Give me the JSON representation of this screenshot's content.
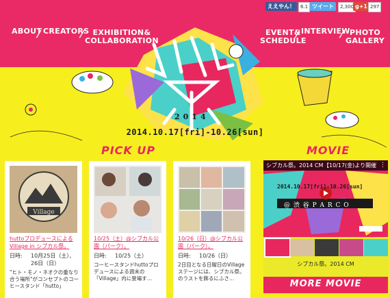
{
  "nav": {
    "about": "ABOUT",
    "creators": "CREATORS",
    "exhibition_line1": "EXHIBITION&",
    "exhibition_line2": "COLLABORATION",
    "event_line1": "EVENT&",
    "event_line2": "SCHEDULE",
    "interview": "INTERVIEW",
    "photo_line1": "PHOTO",
    "photo_line2": "GALLERY"
  },
  "social": {
    "like_label": "ええやん！",
    "like_count": "6.1",
    "tweet_label": "ツイート",
    "tweet_count": "2,300",
    "gplus_label": "g+1",
    "gplus_count": "297"
  },
  "festival": {
    "year": "2014",
    "dates": "2014.10.17[fri]-10.26[sun]"
  },
  "pickup": {
    "heading": "PICK UP",
    "cards": [
      {
        "title": "huttoプロデュースによるVillage in シブカル祭。",
        "date_label": "日時:",
        "date_value": "10月25日（土）、",
        "date_value2": "26日（日）",
        "desc": "\"ヒト・モノ・ネオクの重なり合う場所\"がコンセプトのコーヒースタンド「hutto」"
      },
      {
        "title": "10/25（土）@シブカル公園（パーク）。",
        "date_label": "日時:",
        "date_value": "10/25（土）",
        "desc": "コーヒースタンドhuttoプロデュースによる週末の「Village」内に登場す…"
      },
      {
        "title": "10/26（日）@シブカル公園（パーク）。",
        "date_label": "日時:",
        "date_value": "10/26（日）",
        "desc": "2日目となる日曜日のVillageステージには、シブカル祭。のラストを飾るにふさ…"
      }
    ]
  },
  "movie": {
    "heading": "MOVIE",
    "video_title": "シブカル祭。2014 CM",
    "video_badge": "【10/17(金)より開催",
    "video_overlay_dates": "2014.10.17[fri]-10.26[sun]",
    "video_overlay_place": "@ 渋 谷 P A R C O",
    "caption": "シブカル祭。2014 CM",
    "more_label": "MORE MOVIE"
  },
  "colors": {
    "pink": "#ea2a66",
    "yellow": "#f7ee1e",
    "white": "#ffffff"
  }
}
